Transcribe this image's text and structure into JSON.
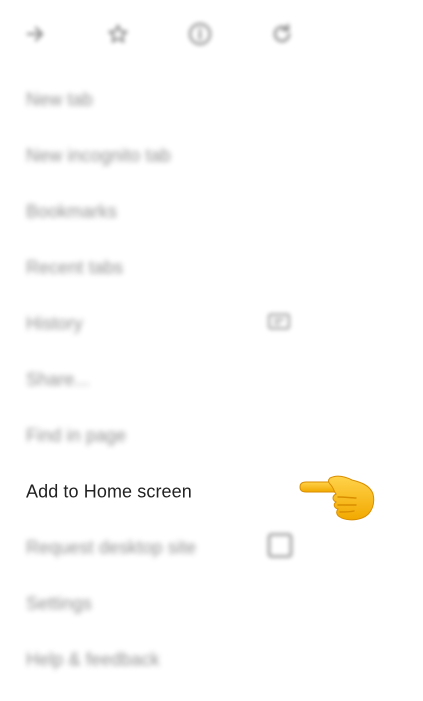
{
  "toolbar": {
    "icons": [
      "forward-arrow-icon",
      "star-icon",
      "info-icon",
      "refresh-icon"
    ]
  },
  "menu": {
    "items": [
      {
        "label": "New tab",
        "state": "blurred"
      },
      {
        "label": "New incognito tab",
        "state": "blurred"
      },
      {
        "label": "Bookmarks",
        "state": "blurred"
      },
      {
        "label": "Recent tabs",
        "state": "blurred"
      },
      {
        "label": "History",
        "state": "blurred",
        "trailing_icon": "history-icon"
      },
      {
        "label": "Share...",
        "state": "blurred"
      },
      {
        "label": "Find in page",
        "state": "blurred"
      },
      {
        "label": "Add to Home screen",
        "state": "focused"
      },
      {
        "label": "Request desktop site",
        "state": "blurred",
        "trailing_icon": "checkbox-unchecked"
      },
      {
        "label": "Settings",
        "state": "blurred"
      },
      {
        "label": "Help & feedback",
        "state": "blurred"
      }
    ]
  },
  "annotation": {
    "icon": "pointing-hand-emoji",
    "color": "#F2B705"
  }
}
